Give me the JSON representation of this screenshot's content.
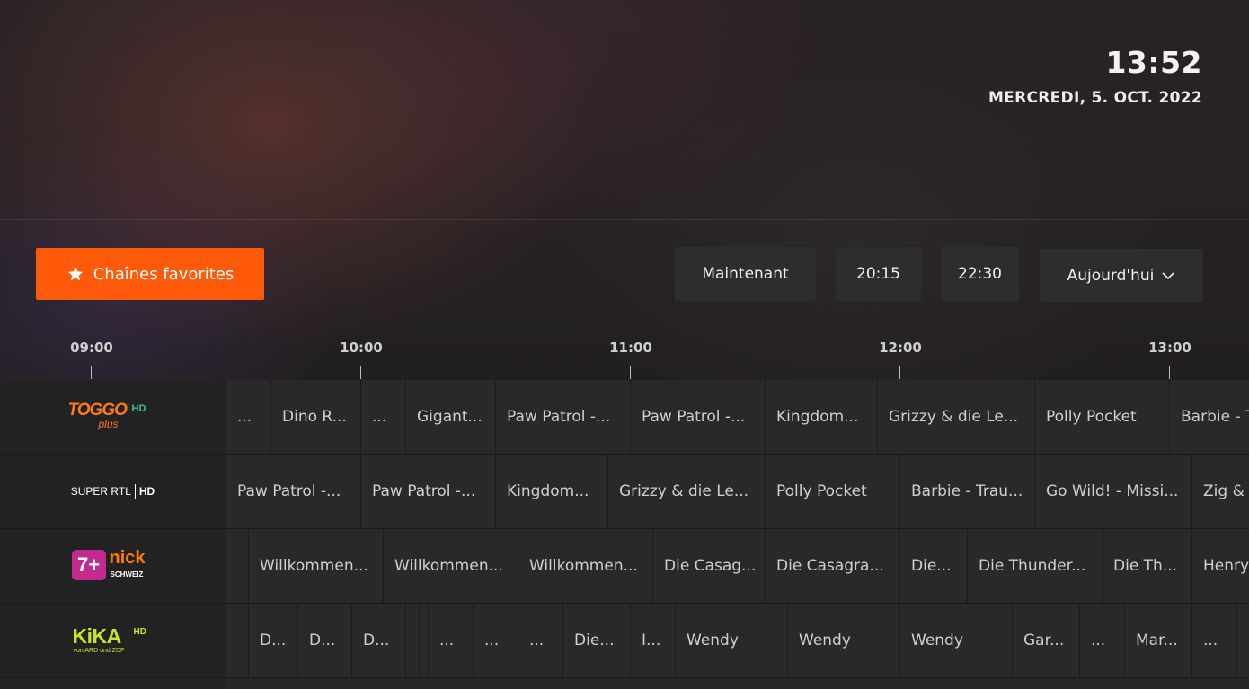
{
  "header": {
    "clock": "13:52",
    "date": "MERCREDI, 5. OCT. 2022"
  },
  "toolbar": {
    "favorites_label": "Chaînes favorites",
    "now_label": "Maintenant",
    "time_2015": "20:15",
    "time_2230": "22:30",
    "day_label": "Aujourd'hui"
  },
  "timeline": {
    "ticks": [
      "09:00",
      "10:00",
      "11:00",
      "12:00",
      "13:00"
    ]
  },
  "channels": [
    {
      "name": "TOGGO plus HD",
      "programs": [
        "...",
        "Dino R...",
        "...",
        "Gigant...",
        "Paw Patrol -...",
        "Paw Patrol -...",
        "Kingdom...",
        "Grizzy & die Le...",
        "Polly Pocket",
        "Barbie - T"
      ]
    },
    {
      "name": "SUPER RTL HD",
      "programs": [
        "Paw Patrol -...",
        "Paw Patrol -...",
        "Kingdom...",
        "Grizzy & die Le...",
        "Polly Pocket",
        "Barbie - Trau...",
        "Go Wild! - Missi...",
        "Zig & S"
      ]
    },
    {
      "name": "7+ nick SCHWEIZ",
      "programs": [
        "",
        "Willkommen...",
        "Willkommen...",
        "Willkommen...",
        "Die Casag...",
        "Die Casagra...",
        "Die...",
        "Die Thunder...",
        "Die Th...",
        "Henry"
      ]
    },
    {
      "name": "KiKA HD von ARD und ZDF",
      "programs": [
        "",
        "",
        "D...",
        "D...",
        "D...",
        "",
        "",
        "...",
        "...",
        "...",
        "Die...",
        "I...",
        "Wendy",
        "Wendy",
        "Wendy",
        "Gar...",
        "...",
        "Mar...",
        "...",
        ""
      ]
    }
  ],
  "logos": {
    "toggo_word": "TOGGO",
    "toggo_plus": "plus",
    "toggo_hd": "HD",
    "superrtl_word": "SUPER RTL",
    "superrtl_hd": "HD",
    "nick_seven": "7+",
    "nick_word": "nick",
    "nick_country": "SCHWEIZ",
    "kika_word": "KiKA",
    "kika_hd": "HD",
    "kika_sub": "von ARD und ZDF"
  },
  "colors": {
    "accent": "#ff5a0a",
    "button_bg": "#2d2d2f",
    "cell_bg": "#29292a"
  }
}
